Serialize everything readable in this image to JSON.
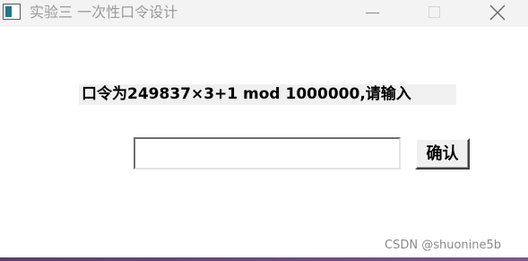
{
  "window": {
    "title": "实验三 一次性口令设计",
    "icon": "window-app-icon",
    "controls": {
      "minimize_icon": "minimize-icon",
      "maximize_icon": "maximize-icon",
      "close_icon": "close-icon"
    }
  },
  "main": {
    "prompt": "口令为249837×3+1 mod 1000000,请输入",
    "password_input": {
      "value": "",
      "placeholder": ""
    },
    "confirm_label": "确认"
  },
  "watermark": "CSDN @shuonine5b",
  "colors": {
    "titlebar_bg": "#f3f3f3",
    "label_bg": "#f0f0f0",
    "bottom_strip": "#6b4a7c"
  }
}
